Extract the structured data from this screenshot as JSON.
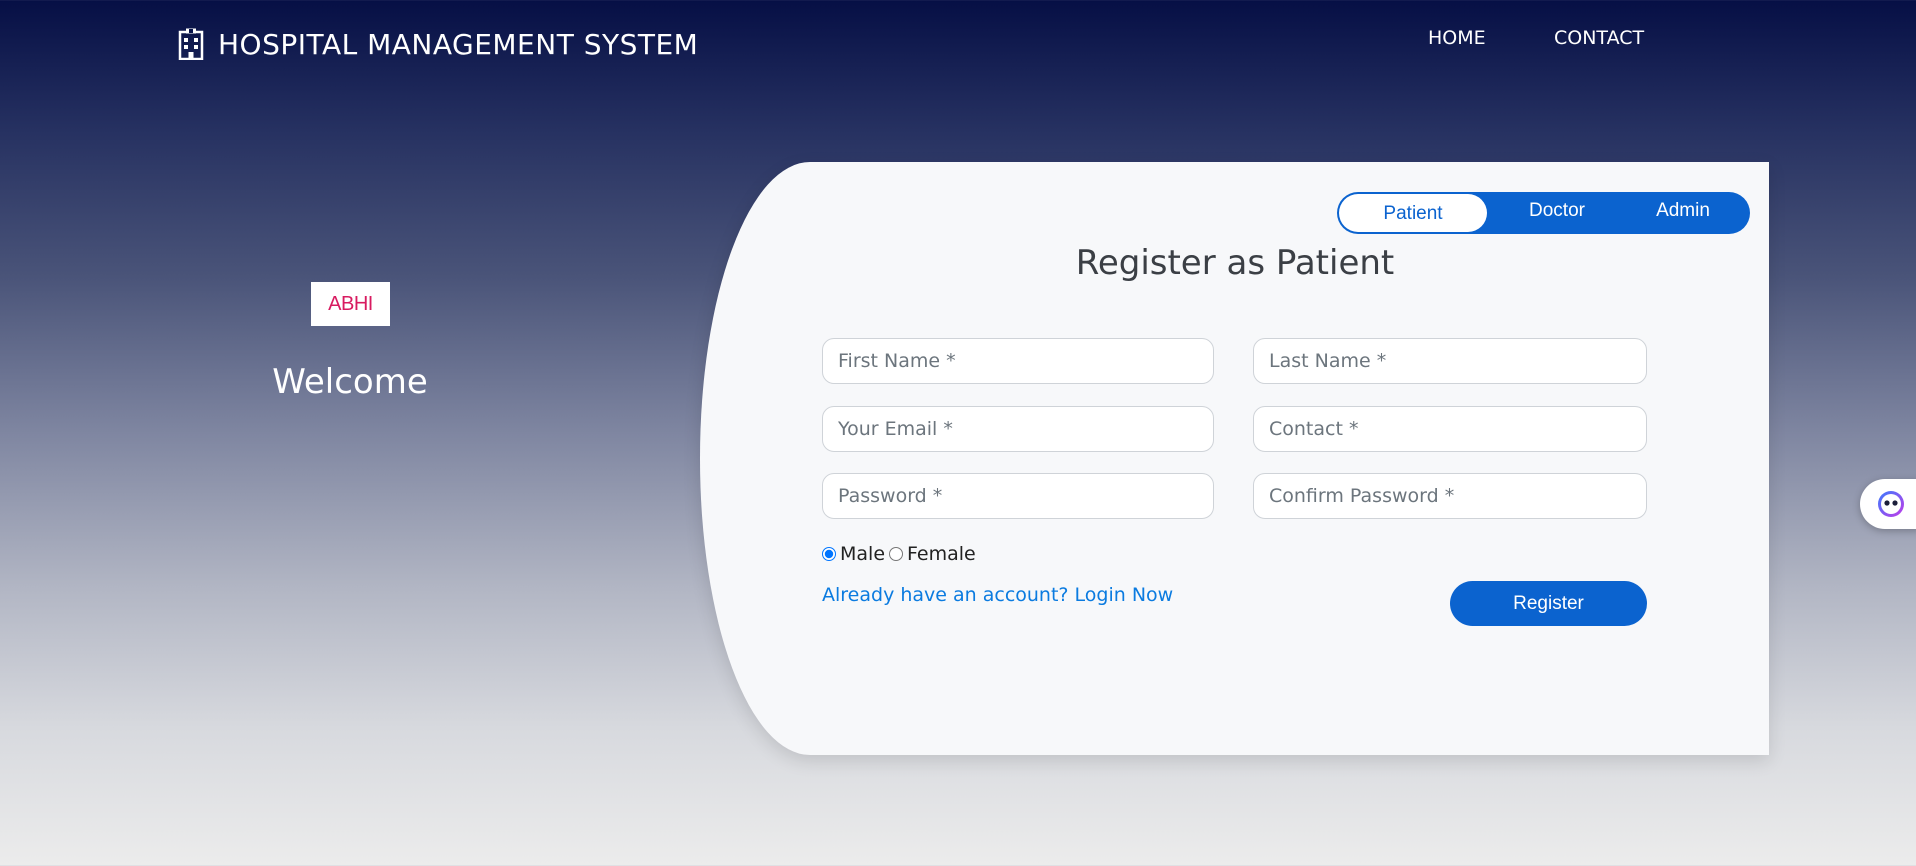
{
  "navbar": {
    "brand_icon": "hospital-building-icon",
    "brand_title": "HOSPITAL MANAGEMENT SYSTEM",
    "links": {
      "home": "HOME",
      "contact": "CONTACT"
    }
  },
  "welcome_panel": {
    "logo_text": "ABHI",
    "welcome_text": "Welcome"
  },
  "role_tabs": {
    "patient": "Patient",
    "doctor": "Doctor",
    "admin": "Admin",
    "selected": "Patient"
  },
  "form": {
    "heading": "Register as Patient",
    "fields": {
      "first_name": {
        "placeholder": "First Name *",
        "value": ""
      },
      "last_name": {
        "placeholder": "Last Name *",
        "value": ""
      },
      "email": {
        "placeholder": "Your Email *",
        "value": ""
      },
      "contact": {
        "placeholder": "Contact *",
        "value": ""
      },
      "password": {
        "placeholder": "Password *",
        "value": ""
      },
      "confirm_password": {
        "placeholder": "Confirm Password *",
        "value": ""
      }
    },
    "gender": {
      "male": "Male",
      "female": "Female",
      "selected": "Male"
    },
    "login_link": "Already have an account? Login Now",
    "register_button": "Register"
  },
  "colors": {
    "primary": "#0b63cf",
    "link": "#0b7be0",
    "logo": "#d81b60",
    "nav_top": "#060f45"
  },
  "floating_widget": {
    "icon": "assistant-face-icon"
  }
}
